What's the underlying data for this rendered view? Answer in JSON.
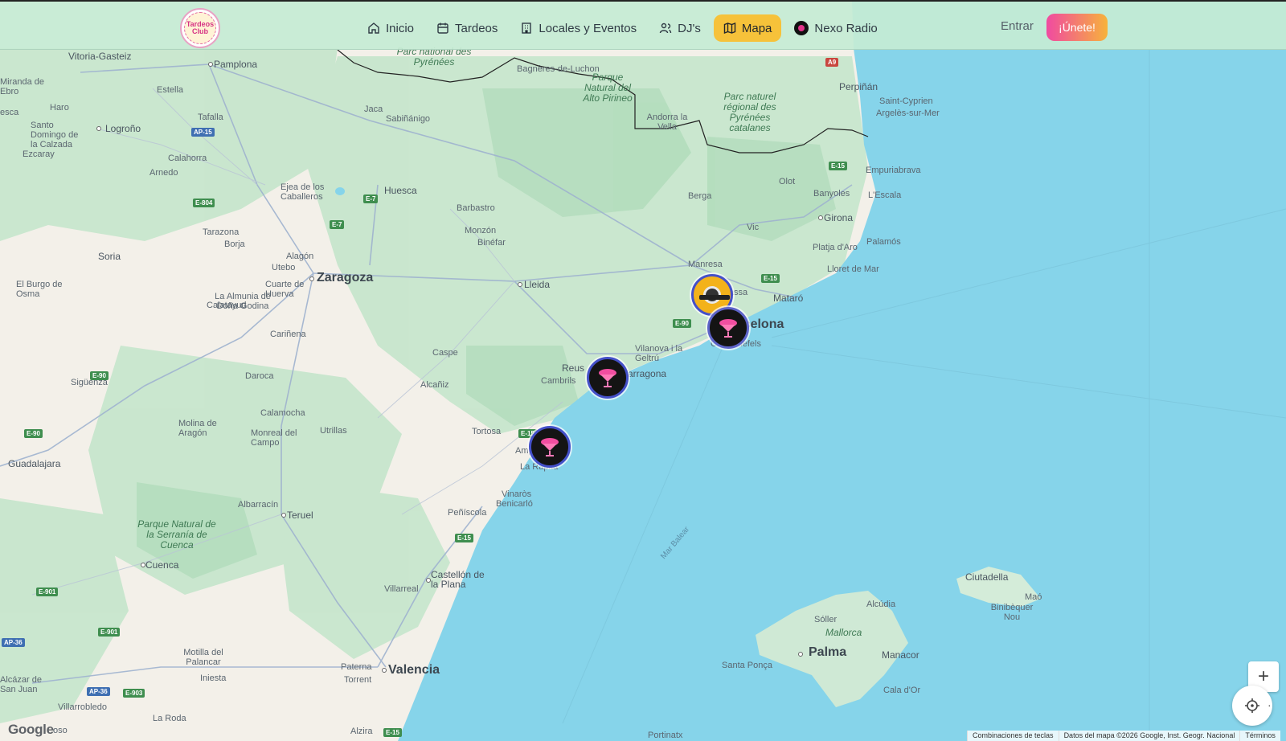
{
  "header": {
    "logo_text": "Tardeos Club",
    "nav": [
      {
        "label": "Inicio",
        "icon": "home-icon"
      },
      {
        "label": "Tardeos",
        "icon": "calendar-icon"
      },
      {
        "label": "Locales y Eventos",
        "icon": "building-icon"
      },
      {
        "label": "DJ's",
        "icon": "users-icon"
      },
      {
        "label": "Mapa",
        "icon": "map-icon",
        "active": true
      },
      {
        "label": "Nexo Radio",
        "icon": "radio-logo-icon"
      }
    ],
    "login_label": "Entrar",
    "join_label": "¡Únete!"
  },
  "map": {
    "labels": {
      "vitoria": "Vitoria-Gasteiz",
      "pamplona": "Pamplona",
      "miranda": "Miranda de Ebro",
      "haro": "Haro",
      "estella": "Estella",
      "jaca": "Jaca",
      "sabinanigo": "Sabiñánigo",
      "bagneres": "Bagnères-de-Luchon",
      "pyrenees": "Parc national des Pyrénées",
      "alto_pirineo": "Parque Natural del Alto Pirineo",
      "andorra": "Andorra la Vella",
      "pirineus_cat": "Parc naturel régional des Pyrénées catalanes",
      "perpignan": "Perpiñán",
      "saint_cyprien": "Saint-Cyprien",
      "argeles": "Argelès-sur-Mer",
      "logrono": "Logroño",
      "tafalla": "Tafalla",
      "santo_domingo": "Santo Domingo de la Calzada",
      "calahorra": "Calahorra",
      "ezcaray": "Ezcaray",
      "arnedo": "Arnedo",
      "ejea": "Ejea de los Caballeros",
      "huesca": "Huesca",
      "barbastro": "Barbastro",
      "monzon": "Monzón",
      "binefar": "Binéfar",
      "berga": "Berga",
      "olot": "Olot",
      "banyoles": "Banyoles",
      "girona": "Girona",
      "empuriabrava": "Empuriabrava",
      "lescala": "L'Escala",
      "vic": "Vic",
      "palamos": "Palamós",
      "aro": "Platja d'Aro",
      "lloret": "Lloret de Mar",
      "manresa": "Manresa",
      "mataro": "Mataró",
      "barcelona": "Barcelona",
      "terrassa": "Terrassa",
      "castelldefels": "Castelldefels",
      "tarazona": "Tarazona",
      "borja": "Borja",
      "soria": "Soria",
      "alagon": "Alagón",
      "utebo": "Utebo",
      "zaragoza": "Zaragoza",
      "lleida": "Lleida",
      "burgo": "El Burgo de Osma",
      "cuarte": "Cuarte de Huerva",
      "almunia": "La Almunia de Doña Godina",
      "calatayud": "Calatayud",
      "carinena": "Cariñena",
      "caspe": "Caspe",
      "vilanova": "Vilanova i la Geltrú",
      "reus": "Reus",
      "tarragona": "Tarragona",
      "cambrils": "Cambrils",
      "siguenza": "Sigüenza",
      "daroca": "Daroca",
      "alcaniz": "Alcañiz",
      "calamocha": "Calamocha",
      "molina": "Molina de Aragón",
      "monreal": "Monreal del Campo",
      "utrillas": "Utrillas",
      "tortosa": "Tortosa",
      "amposta": "Amposta",
      "rapita": "La Ràpita",
      "guadalajara": "Guadalajara",
      "albarracin": "Albarracín",
      "teruel": "Teruel",
      "vinaros": "Vinaròs",
      "benicarlo": "Benicarló",
      "peniscola": "Peñíscola",
      "serrania": "Parque Natural de la Serranía de Cuenca",
      "cuenca": "Cuenca",
      "castellon": "Castellón de la Plana",
      "villarreal": "Villarreal",
      "mar_balear": "Mar Balear",
      "ciutadella": "Ciutadella",
      "mao": "Maó",
      "binibequer": "Binibèquer Nou",
      "alcudia": "Alcúdia",
      "soller": "Sóller",
      "mallorca": "Mallorca",
      "palma": "Palma",
      "manacor": "Manacor",
      "santa_ponsa": "Santa Ponça",
      "cala_dor": "Cala d'Or",
      "motilla": "Motilla del Palancar",
      "iniesta": "Iniesta",
      "paterna": "Paterna",
      "torrent": "Torrent",
      "valencia": "Valencia",
      "alcazar": "Alcázar de San Juan",
      "villarrobledo": "Villarrobledo",
      "la_roda": "La Roda",
      "alzira": "Alzira",
      "portinatx": "Portinatx",
      "esca": "esca",
      "roso": "oso"
    },
    "shields": {
      "ap15": "AP-15",
      "e804": "E-804",
      "e7": "E-7",
      "e7b": "E-7",
      "a9": "A9",
      "e15a": "E-15",
      "e15b": "E-15",
      "e90a": "E-90",
      "e90b": "E-90",
      "e90c": "E-90",
      "e15c": "E-15",
      "e15d": "E-15",
      "e15e": "E-15",
      "e901a": "E-901",
      "e901b": "E-901",
      "ap36a": "AP-36",
      "ap36b": "AP-36",
      "e903": "E-903"
    }
  },
  "markers": [
    {
      "name": "Nexo Radio venue",
      "style": "gold"
    },
    {
      "name": "Tardeos Barcelona",
      "style": "tardeos"
    },
    {
      "name": "Tardeos Tarragona",
      "style": "tardeos"
    },
    {
      "name": "Tardeos Amposta",
      "style": "tardeos"
    }
  ],
  "controls": {
    "zoom_in": "+",
    "locate_dot": "·"
  },
  "footer": {
    "brand": "Google",
    "shortcuts": "Combinaciones de teclas",
    "map_data": "Datos del mapa ©2026 Google, Inst. Geogr. Nacional",
    "terms": "Términos"
  },
  "colors": {
    "sea": "#86d4ea",
    "land": "#f4f1ea",
    "forest": "#bfe3c6",
    "accent": "#f6c23a",
    "marker_ring": "#4450c8"
  }
}
